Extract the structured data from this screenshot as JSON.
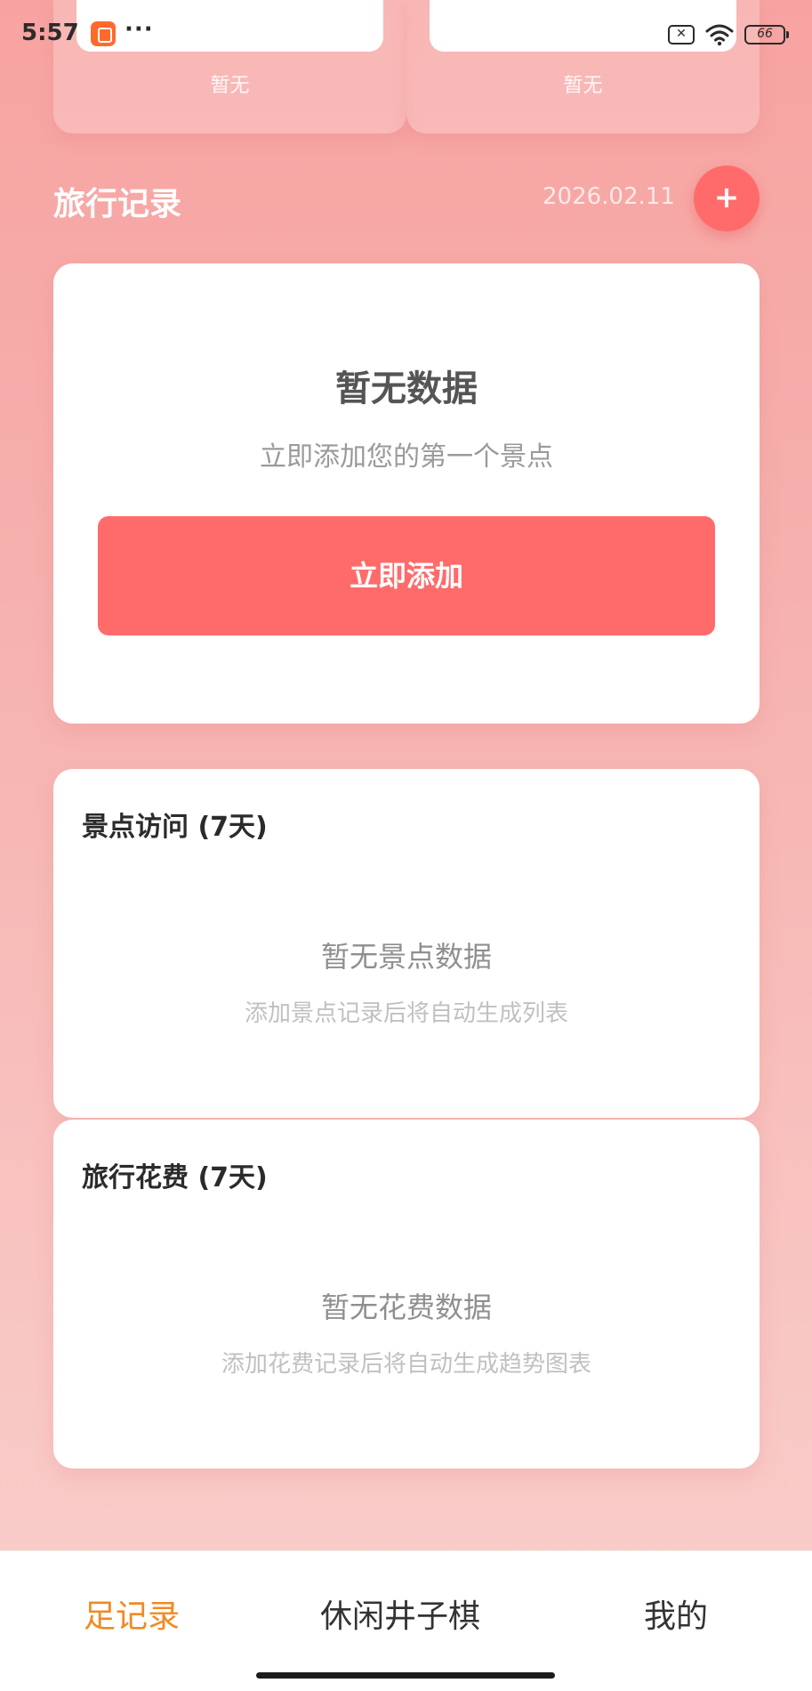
{
  "status_bar": {
    "time": "5:57",
    "dots": "···",
    "battery": "66"
  },
  "top_cards": [
    {
      "empty_label": "暂无"
    },
    {
      "empty_label": "暂无"
    }
  ],
  "section": {
    "title": "旅行记录",
    "date": "2026.02.11",
    "add_icon": "+"
  },
  "empty_state": {
    "title": "暂无数据",
    "subtitle": "立即添加您的第一个景点",
    "button_label": "立即添加"
  },
  "visits_card": {
    "title": "景点访问 (7天)",
    "empty_title": "暂无景点数据",
    "empty_hint": "添加景点记录后将自动生成列表"
  },
  "spend_card": {
    "title": "旅行花费 (7天)",
    "empty_title": "暂无花费数据",
    "empty_hint": "添加花费记录后将自动生成趋势图表"
  },
  "bottom_nav": {
    "items": [
      {
        "label": "足记录",
        "active": true
      },
      {
        "label": "休闲井子棋",
        "active": false
      },
      {
        "label": "我的",
        "active": false
      }
    ],
    "active_color": "#f08a24"
  },
  "colors": {
    "accent": "#ff6b6b",
    "background_top": "#f7a3a1",
    "background_bottom": "#f9cfcc"
  }
}
